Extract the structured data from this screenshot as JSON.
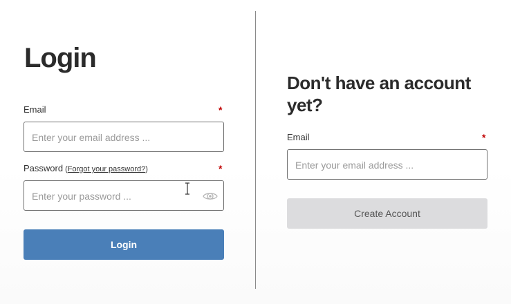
{
  "login": {
    "title": "Login",
    "email_label": "Email",
    "email_placeholder": "Enter your email address ...",
    "password_label": "Password",
    "forgot_open": "(",
    "forgot_link": "Forgot your password?",
    "forgot_close": ")",
    "password_placeholder": "Enter your password ...",
    "required_mark": "*",
    "button": "Login"
  },
  "signup": {
    "title": "Don't have an account yet?",
    "email_label": "Email",
    "email_placeholder": "Enter your email address ...",
    "required_mark": "*",
    "button": "Create Account"
  },
  "colors": {
    "primary": "#4a7fb8",
    "required": "#c00000",
    "disabled_button": "#dcdcde"
  },
  "icons": [
    "eye-icon",
    "text-cursor-icon"
  ]
}
